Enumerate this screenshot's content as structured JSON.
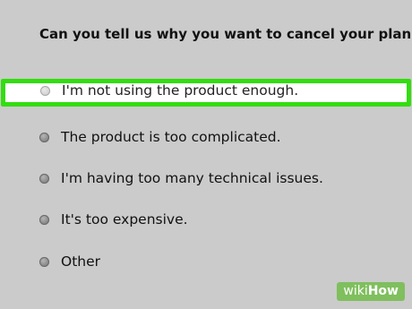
{
  "survey": {
    "question": "Can you tell us why you want to cancel your plan?",
    "options": [
      {
        "label": "I'm not using the product enough.",
        "highlighted": true
      },
      {
        "label": "The product is too complicated.",
        "highlighted": false
      },
      {
        "label": "I'm having too many technical issues.",
        "highlighted": false
      },
      {
        "label": "It's too expensive.",
        "highlighted": false
      },
      {
        "label": "Other",
        "highlighted": false
      }
    ]
  },
  "watermark": {
    "wiki": "wiki",
    "how": "How"
  },
  "colors": {
    "background": "#cbcbcb",
    "highlight_border": "#33dd0f",
    "highlight_fill": "#ffffff",
    "watermark_bg": "#7fbf5e"
  }
}
